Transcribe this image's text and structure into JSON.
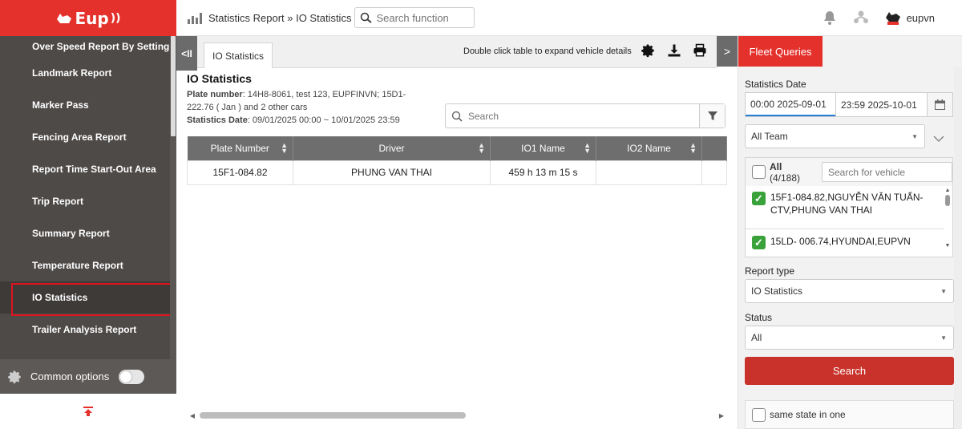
{
  "brand": {
    "name": "Eup"
  },
  "sidebar": {
    "items": [
      {
        "label": "Over Speed Report By Setting",
        "active": false
      },
      {
        "label": "Landmark Report",
        "active": false
      },
      {
        "label": "Marker Pass",
        "active": false
      },
      {
        "label": "Fencing Area Report",
        "active": false
      },
      {
        "label": "Report Time Start-Out Area",
        "active": false
      },
      {
        "label": "Trip Report",
        "active": false
      },
      {
        "label": "Summary Report",
        "active": false
      },
      {
        "label": "Temperature Report",
        "active": false
      },
      {
        "label": "IO Statistics",
        "active": true
      },
      {
        "label": "Trailer Analysis Report",
        "active": false
      }
    ],
    "common_options_label": "Common options",
    "common_options_on": false
  },
  "topbar": {
    "breadcrumb": "Statistics Report » IO Statistics",
    "search_placeholder": "Search function",
    "username": "eupvn"
  },
  "toolbar": {
    "tab_label": "IO Statistics",
    "hint": "Double click table to expand vehicle details"
  },
  "report": {
    "title": "IO Statistics",
    "plate_label": "Plate number",
    "plate_value": ": 14H8-8061, test 123, EUPFINVN; 15D1-222.76 ( Jan ) and 2 other cars",
    "date_label": "Statistics Date",
    "date_value": ": 09/01/2025 00:00 ~ 10/01/2025 23:59",
    "search_placeholder": "Search"
  },
  "table": {
    "columns": [
      "Plate Number",
      "Driver",
      "IO1 Name",
      "IO2 Name",
      ""
    ],
    "rows": [
      [
        "15F1-084.82",
        "PHUNG VAN THAI",
        "459 h 13 m 15 s",
        "",
        ""
      ]
    ]
  },
  "panel": {
    "tab_label": "Fleet Queries",
    "stat_date_label": "Statistics Date",
    "date_start": "00:00 2025-09-01",
    "date_end": "23:59 2025-10-01",
    "team_value": "All Team",
    "all_label": "All",
    "all_count": "(4/188)",
    "vehicle_search_placeholder": "Search for vehicle",
    "vehicles": [
      {
        "label": "15F1-084.82,NGUYỄN VĂN TUẤN- CTV,PHUNG VAN THAI",
        "checked": true
      },
      {
        "label": "15LD- 006.74,HYUNDAI,EUPVN",
        "checked": true
      }
    ],
    "report_type_label": "Report type",
    "report_type_value": "IO Statistics",
    "status_label": "Status",
    "status_value": "All",
    "search_button": "Search",
    "same_state_label": "same state in one"
  },
  "colors": {
    "brand_red": "#e4312c",
    "sidebar_bg": "#4d4a48",
    "check_green": "#3aa23a"
  }
}
